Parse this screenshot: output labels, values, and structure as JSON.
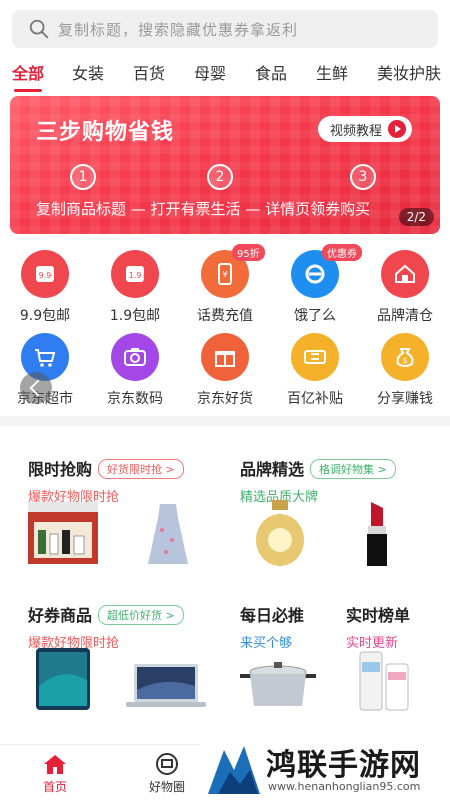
{
  "search": {
    "placeholder": "复制标题，搜索隐藏优惠券拿返利"
  },
  "tabs": [
    "全部",
    "女装",
    "百货",
    "母婴",
    "食品",
    "生鲜",
    "美妆护肤"
  ],
  "banner": {
    "title": "三步购物省钱",
    "video_label": "视频教程",
    "step_numbers": [
      "1",
      "2",
      "3"
    ],
    "steps_text": "复制商品标题 — 打开有票生活 — 详情页领券购买",
    "page_indicator": "2/2"
  },
  "categories_row1": [
    {
      "label": "9.9包邮",
      "icon": "9.9-tag-icon",
      "color": "#f0474f"
    },
    {
      "label": "1.9包邮",
      "icon": "1.9-tag-icon",
      "color": "#f0474f"
    },
    {
      "label": "话费充值",
      "icon": "phone-recharge-icon",
      "color": "#f26b3a",
      "badge": "95折"
    },
    {
      "label": "饿了么",
      "icon": "eleme-icon",
      "color": "#1e8ff0",
      "badge": "优惠券"
    },
    {
      "label": "品牌清仓",
      "icon": "house-icon",
      "color": "#f0474f"
    }
  ],
  "categories_row2": [
    {
      "label": "京东超市",
      "icon": "cart-icon",
      "color": "#2f7df0"
    },
    {
      "label": "京东数码",
      "icon": "camera-icon",
      "color": "#a347e6"
    },
    {
      "label": "京东好货",
      "icon": "gift-icon",
      "color": "#f0633a"
    },
    {
      "label": "百亿补贴",
      "icon": "ticket-icon",
      "color": "#f5b12a"
    },
    {
      "label": "分享赚钱",
      "icon": "money-bag-icon",
      "color": "#f5b12a"
    }
  ],
  "cards": {
    "flash": {
      "title": "限时抢购",
      "pill": "好货限时抢 >",
      "sub": "爆款好物限时抢"
    },
    "brand": {
      "title": "品牌精选",
      "pill": "格调好物集 >",
      "sub": "精选品质大牌"
    },
    "coupon": {
      "title": "好券商品",
      "pill": "超低价好货 >",
      "sub": "爆款好物限时抢"
    },
    "daily": {
      "title": "每日必推",
      "sub": "来买个够"
    },
    "ranking": {
      "title": "实时榜单",
      "sub": "实时更新"
    }
  },
  "bottom_nav": [
    {
      "label": "首页",
      "active": true
    },
    {
      "label": "好物圈",
      "active": false
    }
  ],
  "watermark": {
    "text": "鸿联手游网",
    "url": "www.henanhonglian95.com"
  },
  "colors": {
    "accent": "#e5213a"
  }
}
